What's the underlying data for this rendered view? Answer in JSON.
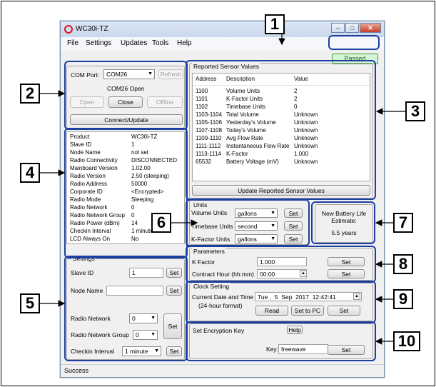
{
  "window": {
    "title": "WC30i-TZ",
    "min": "–",
    "max": "□",
    "close": "✕"
  },
  "menu": [
    "File",
    "Settings",
    "Updates",
    "Tools",
    "Help"
  ],
  "status_badge": "Passed",
  "com": {
    "port_label": "COM Port:",
    "port_value": "COM26",
    "refresh": "Refresh",
    "status": "COM26 Open",
    "open": "Open",
    "close": "Close",
    "offline": "Offline",
    "connect": "Connect/Update"
  },
  "properties": [
    [
      "Product",
      "WC30i-TZ"
    ],
    [
      "Slave ID",
      "1"
    ],
    [
      "Node Name",
      "not set"
    ],
    [
      "Radio Connectivity",
      "DISCONNECTED"
    ],
    [
      "Mainboard Version",
      "1.02.00"
    ],
    [
      "Radio Version",
      "2.50 (sleeping)"
    ],
    [
      "Radio Address",
      "50000"
    ],
    [
      "Corporate ID",
      "<Encrypted>"
    ],
    [
      "Radio Mode",
      "Sleeping"
    ],
    [
      "Radio Network",
      "0"
    ],
    [
      "Radio Network Group",
      "0"
    ],
    [
      "Radio Power (dBm)",
      "14"
    ],
    [
      "Checkin Interval",
      "1 minute"
    ],
    [
      "LCD Always On",
      "No"
    ]
  ],
  "settings": {
    "title": "Settings",
    "slave_id_label": "Slave ID",
    "slave_id": "1",
    "set": "Set",
    "node_name_label": "Node Name",
    "node_name": "",
    "radio_network_label": "Radio Network",
    "radio_network": "0",
    "radio_group_label": "Radio Network Group",
    "radio_group": "0",
    "checkin_label": "Checkin Interval",
    "checkin": "1 minute"
  },
  "sensors": {
    "title": "Reported Sensor Values",
    "headers": [
      "Address",
      "Description",
      "Value"
    ],
    "rows": [
      [
        "1100",
        "Volume Units",
        "2"
      ],
      [
        "1101",
        "K-Factor Units",
        "2"
      ],
      [
        "1102",
        "Timebase Units",
        "0"
      ],
      [
        "1103-1104",
        "Total Volume",
        "Unknown"
      ],
      [
        "1105-1106",
        "Yesterday's Volume",
        "Unknown"
      ],
      [
        "1107-1108",
        "Today's Volume",
        "Unknown"
      ],
      [
        "1109-1110",
        "Avg Flow Rate",
        "Unknown"
      ],
      [
        "1111-1112",
        "Instantaneous Flow Rate",
        "Unknown"
      ],
      [
        "1113-1114",
        "K-Factor",
        "1.000"
      ],
      [
        "65532",
        "Battery Voltage (mV)",
        "Unknown"
      ]
    ],
    "update": "Update Reported Sensor Values"
  },
  "units": {
    "title": "Units",
    "volume_label": "Volume Units",
    "volume": "gallons",
    "timebase_label": "Timebase Units",
    "timebase": "second",
    "kfactor_label": "K-Factor Units",
    "kfactor": "gallons",
    "set": "Set"
  },
  "battery": {
    "line1": "New Battery Life",
    "line2": "Estimate:",
    "value": "5.5 years"
  },
  "parameters": {
    "title": "Parameters",
    "kfactor_label": "K Factor",
    "kfactor": "1.000",
    "contract_label": "Contract Hour (hh:mm)",
    "contract": "00:00",
    "set": "Set"
  },
  "clock": {
    "title": "Clock Setting",
    "label1": "Current Date and Time",
    "label2": "(24-hour format)",
    "value": "Tue ,  5  Sep  2017  12:42:41",
    "read": "Read",
    "set_pc": "Set to PC",
    "set": "Set"
  },
  "encryption": {
    "title": "Set Encryption Key",
    "help": "Help",
    "key_label": "Key:",
    "key": "freewave",
    "set": "Set"
  },
  "status_text": "Success",
  "callouts": [
    "1",
    "2",
    "3",
    "4",
    "5",
    "6",
    "7",
    "8",
    "9",
    "10"
  ]
}
